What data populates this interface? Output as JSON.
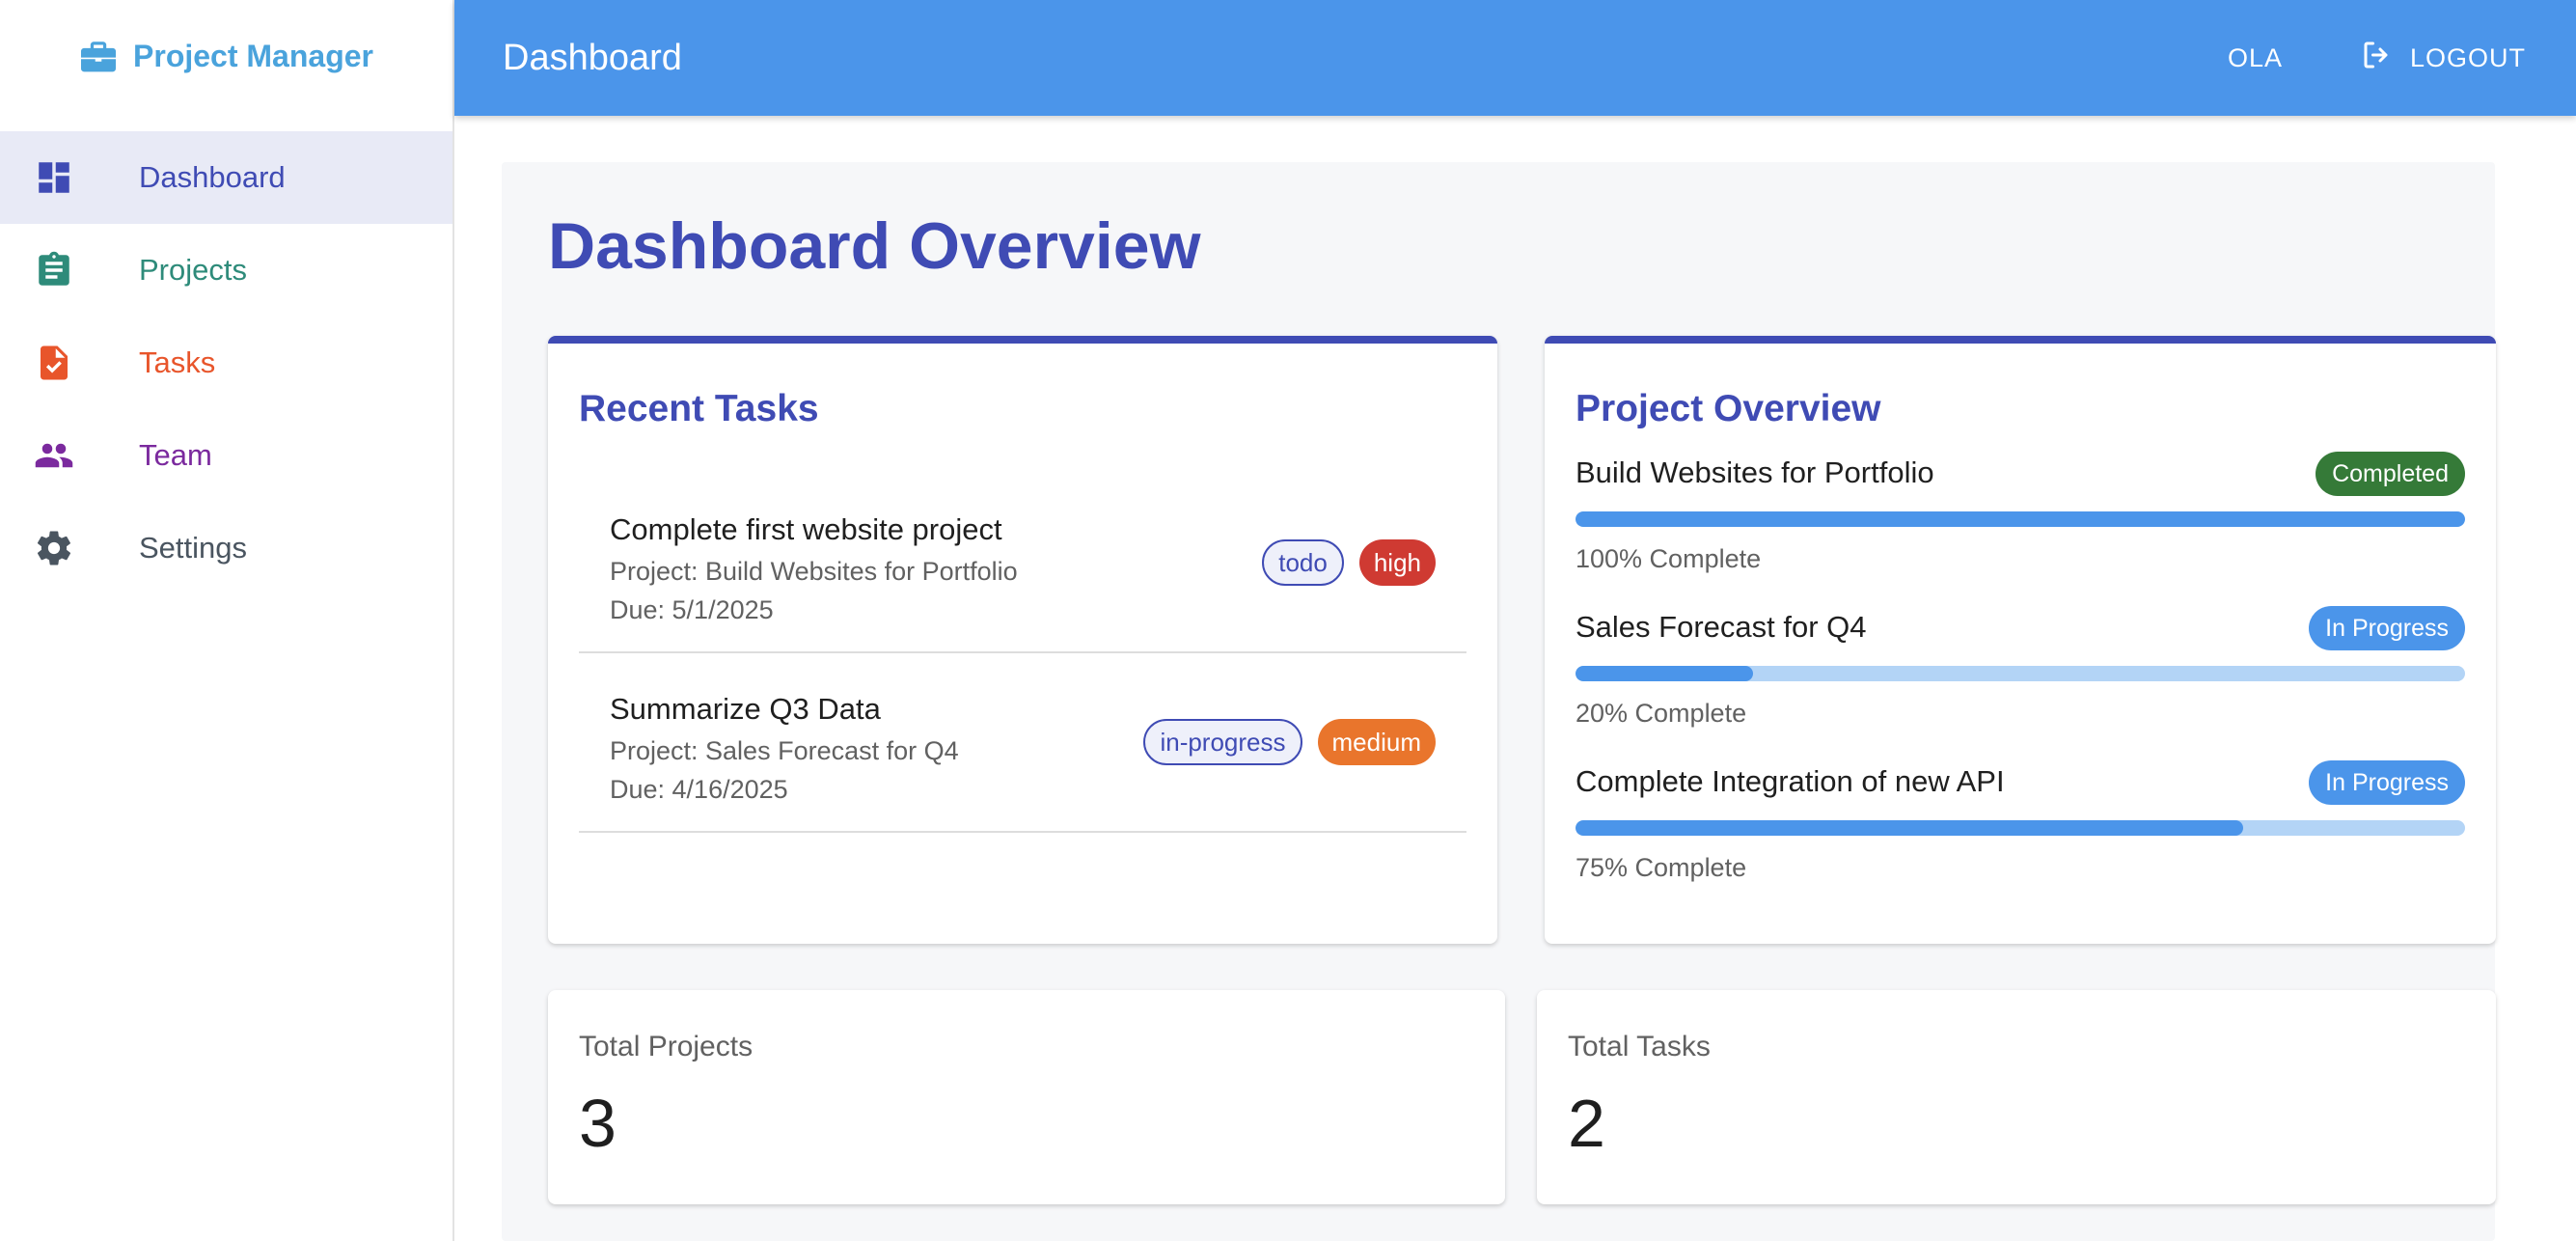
{
  "brand": {
    "title": "Project Manager",
    "icon": "briefcase-icon",
    "color": "#4aa3dc"
  },
  "sidebar": {
    "items": [
      {
        "label": "Dashboard",
        "icon": "dashboard-icon",
        "color": "#3f4bb4",
        "active": true
      },
      {
        "label": "Projects",
        "icon": "clipboard-icon",
        "color": "#2e8b7a",
        "active": false
      },
      {
        "label": "Tasks",
        "icon": "task-file-icon",
        "color": "#e8552b",
        "active": false
      },
      {
        "label": "Team",
        "icon": "people-icon",
        "color": "#7b2a9e",
        "active": false
      },
      {
        "label": "Settings",
        "icon": "gear-icon",
        "color": "#4a5560",
        "active": false
      }
    ]
  },
  "header": {
    "title": "Dashboard",
    "user": "OLA",
    "logout_label": "LOGOUT",
    "color": "#4b95ea"
  },
  "main": {
    "title": "Dashboard Overview",
    "recent_tasks": {
      "title": "Recent Tasks",
      "items": [
        {
          "name": "Complete first website project",
          "project": "Project: Build Websites for Portfolio",
          "due": "Due: 5/1/2025",
          "status": "todo",
          "priority": "high"
        },
        {
          "name": "Summarize Q3 Data",
          "project": "Project: Sales Forecast for Q4",
          "due": "Due: 4/16/2025",
          "status": "in-progress",
          "priority": "medium"
        }
      ]
    },
    "project_overview": {
      "title": "Project Overview",
      "items": [
        {
          "name": "Build Websites for Portfolio",
          "status": "Completed",
          "progress": 100,
          "progress_label": "100% Complete"
        },
        {
          "name": "Sales Forecast for Q4",
          "status": "In Progress",
          "progress": 20,
          "progress_label": "20% Complete"
        },
        {
          "name": "Complete Integration of new API",
          "status": "In Progress",
          "progress": 75,
          "progress_label": "75% Complete"
        }
      ]
    },
    "stats": {
      "total_projects_label": "Total Projects",
      "total_projects": "3",
      "total_tasks_label": "Total Tasks",
      "total_tasks": "2"
    }
  }
}
